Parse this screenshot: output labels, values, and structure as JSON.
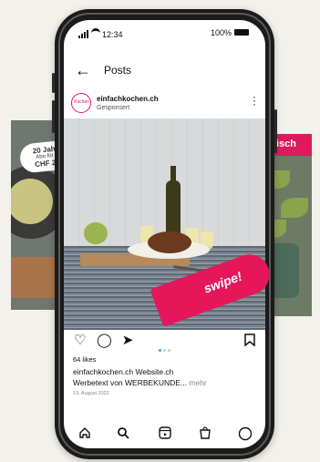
{
  "status_bar": {
    "time": "12:34",
    "battery": "100%"
  },
  "header": {
    "title": "Posts"
  },
  "post": {
    "account": "einfachkochen.ch",
    "subtitle": "Gesponsert",
    "avatar_text": "Kochen",
    "swipe_label": "swipe!",
    "likes": "64 likes",
    "caption_line1": "einfachkochen.ch Website.ch",
    "caption_line2": "Werbetext von WERBEKUNDE...",
    "caption_more": " mehr",
    "date": "13. August 2022",
    "carousel": {
      "count": 3,
      "active": 1
    }
  },
  "side_cards": {
    "left_promo_line1": "20 Jah",
    "left_promo_line2": "Abo für",
    "left_promo_line3": "CHF 2",
    "right_tag": "getarisch"
  },
  "colors": {
    "accent": "#e5175a",
    "carousel_active": "#3897f0"
  },
  "icons": {
    "actions": [
      "heart-icon",
      "comment-icon",
      "send-icon",
      "bookmark-icon"
    ],
    "tabs": [
      "home-icon",
      "search-icon",
      "reels-icon",
      "shop-icon",
      "profile-icon"
    ]
  }
}
